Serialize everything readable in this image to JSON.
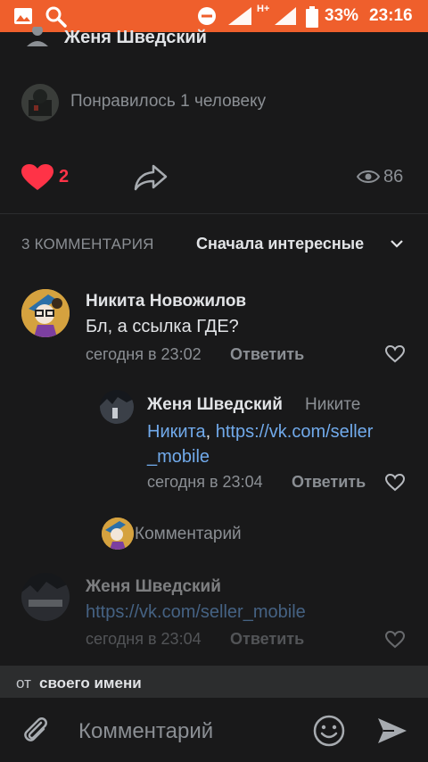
{
  "status_bar": {
    "signal_label": "H+",
    "battery_percent": "33%",
    "time": "23:16",
    "icons": [
      "image-icon",
      "search-icon",
      "dnd-icon",
      "signal-icon",
      "battery-icon"
    ]
  },
  "post": {
    "author": "Женя Шведский",
    "liked_by_text": "Понравилось 1 человеку",
    "likes_count": "2",
    "views_count": "86",
    "colors": {
      "like": "#ff3347",
      "link": "#71aaeb",
      "status_bar": "#ef5f2c"
    }
  },
  "comments_header": {
    "count_label": "3 КОММЕНТАРИЯ",
    "sort_label": "Сначала интересные"
  },
  "comments": [
    {
      "author": "Никита Новожилов",
      "text": "Бл, а ссылка ГДЕ?",
      "time": "сегодня в 23:02",
      "reply_label": "Ответить"
    },
    {
      "author": "Женя Шведский",
      "reply_to": "Никите",
      "mention": "Никита",
      "mention_sep": ",",
      "link_line1": "https://vk.com/seller",
      "link_line2": "_mobile",
      "time": "сегодня в 23:04",
      "reply_label": "Ответить"
    },
    {
      "author": "Женя Шведский",
      "link": "https://vk.com/seller_mobile",
      "time": "сегодня в 23:04",
      "reply_label": "Ответить"
    }
  ],
  "reply_prompt": {
    "placeholder": "Комментарий"
  },
  "as_identity": {
    "prefix": "от",
    "value": "своего имени"
  },
  "composer": {
    "placeholder": "Комментарий"
  }
}
